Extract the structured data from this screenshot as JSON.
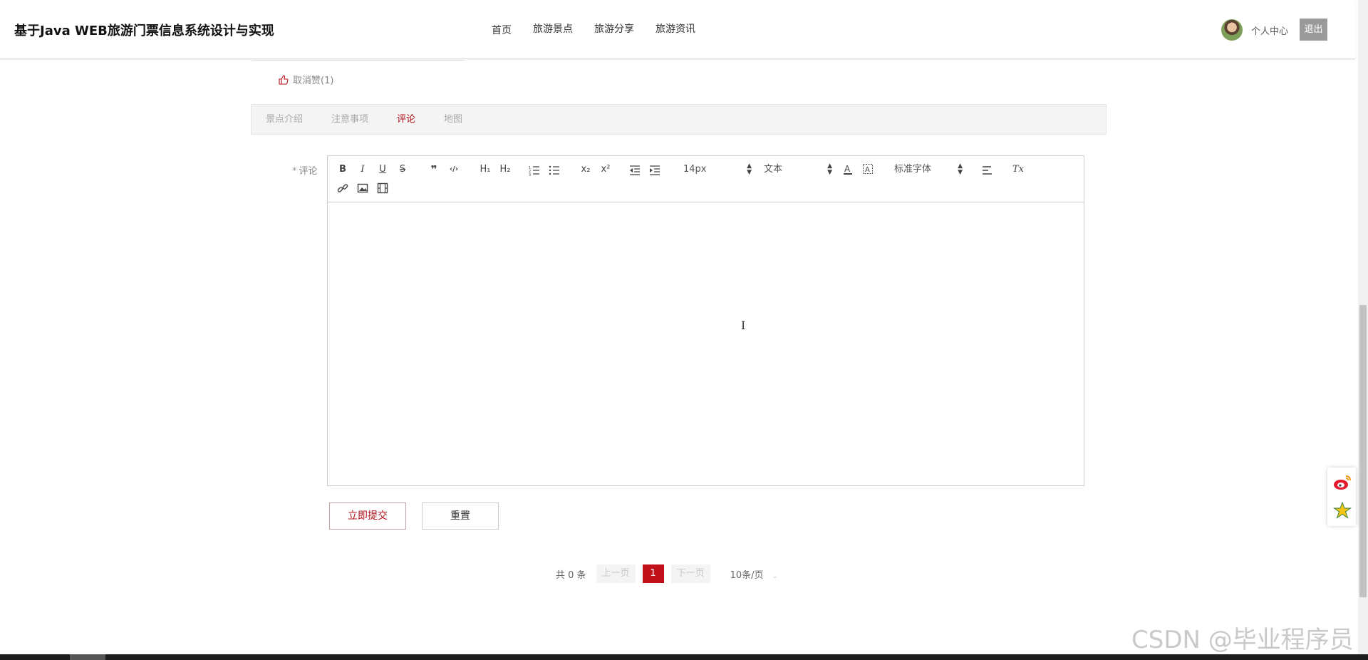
{
  "header": {
    "site_title": "基于Java WEB旅游门票信息系统设计与实现",
    "nav": [
      "首页",
      "旅游景点",
      "旅游分享",
      "旅游资讯"
    ],
    "user_center": "个人中心",
    "logout": "退出"
  },
  "like": {
    "label": "取消赞(1)"
  },
  "tabs": [
    "景点介绍",
    "注意事项",
    "评论",
    "地图"
  ],
  "active_tab": "评论",
  "comment_form": {
    "required_mark": "*",
    "label": "评论",
    "toolbar": {
      "bold": "B",
      "italic": "I",
      "underline": "U",
      "strike": "S",
      "quote": "❞",
      "code": "‹/›",
      "h1": "H₁",
      "h2": "H₂",
      "subscript": "x₂",
      "superscript": "x²",
      "font_size": "14px",
      "paragraph": "文本",
      "font_family": "标准字体",
      "clean": "Tx"
    },
    "submit_label": "立即提交",
    "reset_label": "重置"
  },
  "pagination": {
    "total": "共 0 条",
    "prev": "上一页",
    "current": "1",
    "next": "下一页",
    "page_size": "10条/页"
  },
  "watermark": "CSDN @毕业程序员",
  "colors": {
    "accent": "#c0101a",
    "logout_bg": "#9a9a9a"
  }
}
